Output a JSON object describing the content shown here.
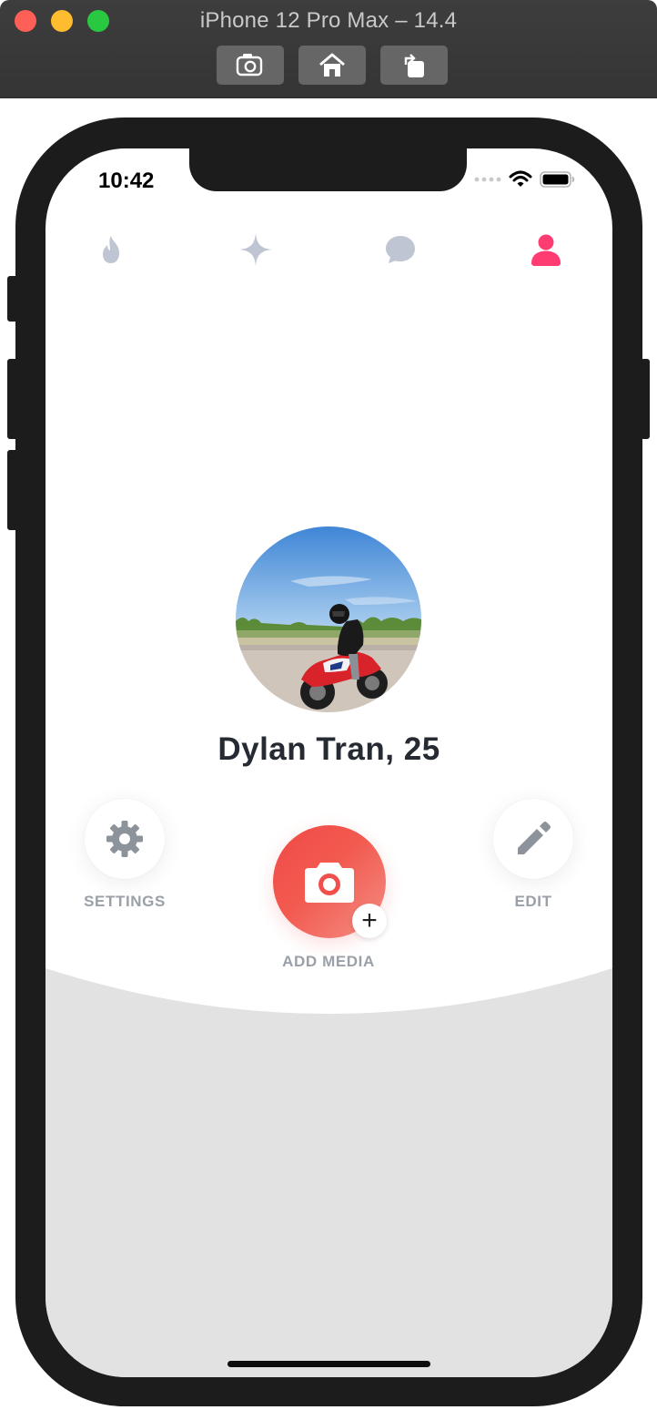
{
  "window": {
    "title": "iPhone 12 Pro Max – 14.4",
    "buttons": [
      "screenshot-icon",
      "home-icon",
      "rotate-icon"
    ]
  },
  "status_bar": {
    "time": "10:42"
  },
  "tabs": [
    {
      "name": "discover",
      "icon": "flame-icon",
      "active": false
    },
    {
      "name": "top-picks",
      "icon": "sparkle-icon",
      "active": false
    },
    {
      "name": "messages",
      "icon": "chat-bubble-icon",
      "active": false
    },
    {
      "name": "profile",
      "icon": "person-icon",
      "active": true
    }
  ],
  "profile": {
    "name": "Dylan Tran, 25"
  },
  "actions": {
    "settings_label": "SETTINGS",
    "add_media_label": "ADD MEDIA",
    "edit_label": "EDIT",
    "plus": "+"
  },
  "colors": {
    "active_tab": "#fe3c72",
    "inactive_tab": "#bfc5d2",
    "accent_gradient_start": "#f04a47",
    "accent_gradient_end": "#f48e86",
    "bottom_area": "#e2e2e2"
  }
}
